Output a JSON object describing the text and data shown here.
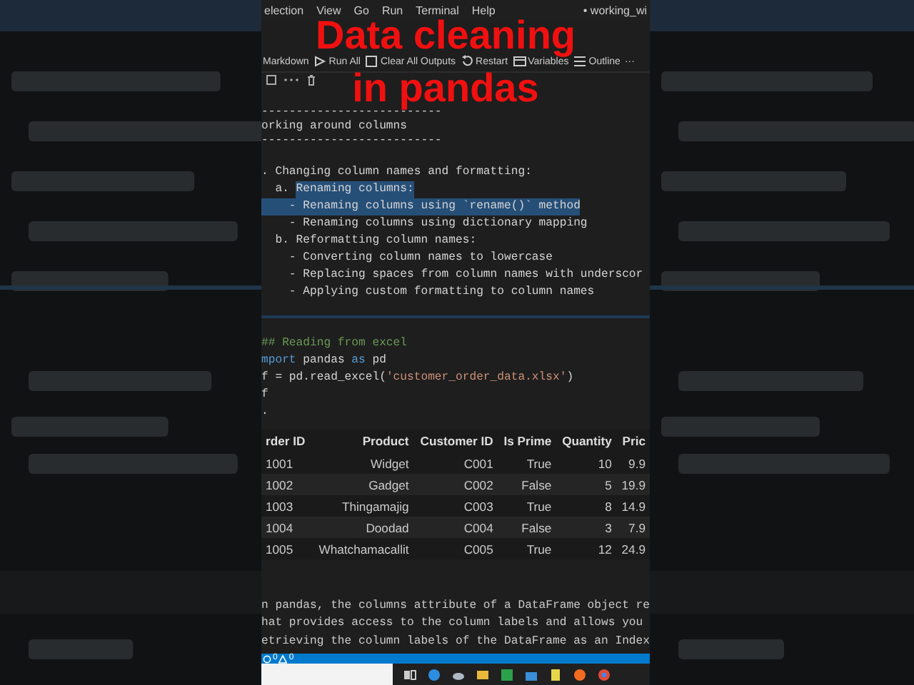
{
  "video_title": [
    "Data cleaning",
    "in pandas"
  ],
  "menu": [
    "election",
    "View",
    "Go",
    "Run",
    "Terminal",
    "Help"
  ],
  "window_title": "• working_wi",
  "toolbar": [
    {
      "label": "Markdown",
      "kind": "text"
    },
    {
      "label": "Run All",
      "kind": "run"
    },
    {
      "label": "Clear All Outputs",
      "kind": "clear"
    },
    {
      "label": "Restart",
      "kind": "restart"
    },
    {
      "label": "Variables",
      "kind": "variables"
    },
    {
      "label": "Outline",
      "kind": "outline"
    },
    {
      "label": "···",
      "kind": "more"
    }
  ],
  "markdown_lines": [
    {
      "kind": "rule",
      "text": "--------------------------",
      "selected": false
    },
    {
      "kind": "line",
      "text": "orking around columns",
      "selected": false
    },
    {
      "kind": "rule",
      "text": "--------------------------",
      "selected": false
    },
    {
      "kind": "line",
      "blank_before": true,
      "text": ". Changing column names and formatting:",
      "selected": false
    },
    {
      "kind": "line",
      "lead": "  a. ",
      "text": "Renaming columns:",
      "selected": true
    },
    {
      "kind": "line",
      "text": "    - Renaming columns using `rename()` method",
      "selected": true
    },
    {
      "kind": "line",
      "text": "    - Renaming columns using dictionary mapping",
      "selected": false
    },
    {
      "kind": "line",
      "text": "  b. Reformatting column names:",
      "selected": false
    },
    {
      "kind": "line",
      "text": "    - Converting column names to lowercase",
      "selected": false
    },
    {
      "kind": "line",
      "text": "    - Replacing spaces from column names with underscor",
      "selected": false
    },
    {
      "kind": "line",
      "text": "    - Applying custom formatting to column names",
      "selected": false
    }
  ],
  "code_lines": [
    [
      {
        "text": "## Reading from excel",
        "kind": "comment"
      }
    ],
    [
      {
        "text": "mport",
        "kind": "keyword"
      },
      {
        "text": " pandas ",
        "kind": "plain"
      },
      {
        "text": "as",
        "kind": "keyword"
      },
      {
        "text": " pd",
        "kind": "plain"
      }
    ],
    [
      {
        "text": "f = pd.read_excel(",
        "kind": "plain"
      },
      {
        "text": "'customer_order_data.xlsx'",
        "kind": "string"
      },
      {
        "text": ")",
        "kind": "plain"
      }
    ],
    [
      {
        "text": "f",
        "kind": "plain"
      }
    ],
    [
      {
        "text": ".",
        "kind": "plain"
      }
    ]
  ],
  "table": {
    "columns": [
      "rder ID",
      "Product",
      "Customer ID",
      "Is Prime",
      "Quantity",
      "Pric"
    ],
    "rows": [
      [
        "1001",
        "Widget",
        "C001",
        "True",
        "10",
        "9.9"
      ],
      [
        "1002",
        "Gadget",
        "C002",
        "False",
        "5",
        "19.9"
      ],
      [
        "1003",
        "Thingamajig",
        "C003",
        "True",
        "8",
        "14.9"
      ],
      [
        "1004",
        "Doodad",
        "C004",
        "False",
        "3",
        "7.9"
      ],
      [
        "1005",
        "Whatchamacallit",
        "C005",
        "True",
        "12",
        "24.9"
      ]
    ]
  },
  "explanation": [
    "n pandas, the columns attribute of a DataFrame object re",
    "hat provides access to the column labels and allows you",
    "etrieving the column labels of the DataFrame as an Index"
  ],
  "status_bar": {
    "errors": "0",
    "warnings": "0"
  }
}
